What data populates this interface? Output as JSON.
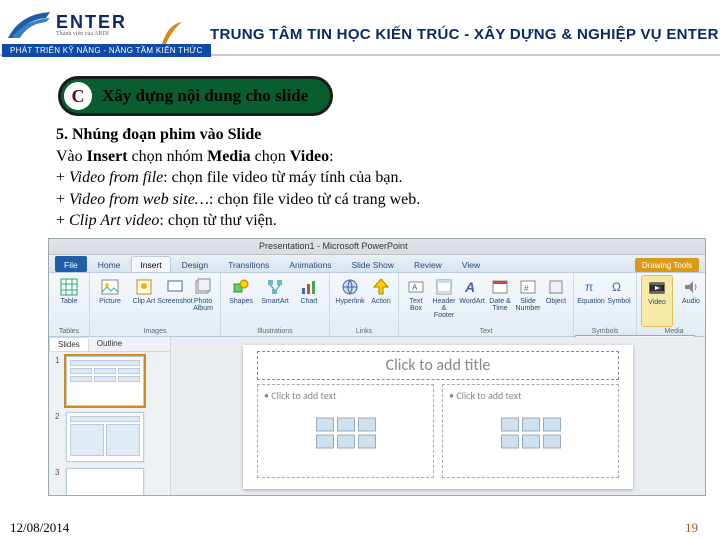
{
  "header": {
    "brand": "ENTER",
    "brand_sub": "Thành viên của ARDI",
    "tagline": "PHÁT TRIỂN KỸ NĂNG - NÂNG TẦM KIẾN THỨC",
    "center_title": "TRUNG TÂM TIN HỌC KIẾN TRÚC - XÂY DỰNG & NGHIỆP VỤ ENTER"
  },
  "section": {
    "letter": "C",
    "title": "Xây dựng nội dung cho slide"
  },
  "body": {
    "line1_head": "5.   Nhúng đoạn phim vào Slide",
    "line2_a": "Vào ",
    "line2_b": "Insert",
    "line2_c": " chọn nhóm ",
    "line2_d": "Media",
    "line2_e": "  chọn ",
    "line2_f": "Video",
    "line2_g": ":",
    "line3_a": "+ ",
    "line3_b": "Video from file",
    "line3_c": ": chọn file video từ máy tính của bạn.",
    "line4_a": "+ ",
    "line4_b": "Video from web site…",
    "line4_c": ": chọn file video từ cá trang web.",
    "line5_a": "+ ",
    "line5_b": "Clip Art video",
    "line5_c": ": chọn từ thư viện."
  },
  "ppt": {
    "window_title": "Presentation1 - Microsoft PowerPoint",
    "tabs": [
      "File",
      "Home",
      "Insert",
      "Design",
      "Transitions",
      "Animations",
      "Slide Show",
      "Review",
      "View"
    ],
    "tab_right": "Drawing Tools",
    "groups": {
      "tables": {
        "name": "Tables",
        "items": [
          "Table"
        ]
      },
      "images": {
        "name": "Images",
        "items": [
          "Picture",
          "Clip Art",
          "Screenshot",
          "Photo Album"
        ]
      },
      "illustrations": {
        "name": "Illustrations",
        "items": [
          "Shapes",
          "SmartArt",
          "Chart"
        ]
      },
      "links": {
        "name": "Links",
        "items": [
          "Hyperlink",
          "Action"
        ]
      },
      "text": {
        "name": "Text",
        "items": [
          "Text Box",
          "Header & Footer",
          "WordArt",
          "Date & Time",
          "Slide Number",
          "Object"
        ]
      },
      "symbols": {
        "name": "Symbols",
        "items": [
          "Equation",
          "Symbol"
        ]
      },
      "media": {
        "name": "Media",
        "items": [
          "Video",
          "Audio"
        ]
      }
    },
    "thumb_tabs": [
      "Slides",
      "Outline"
    ],
    "slide_title_ph": "Click to add title",
    "slide_text_ph": "Click to add text",
    "dropdown": [
      "Video from File...",
      "Video from Web Site...",
      "Clip Art Video..."
    ]
  },
  "footer": {
    "date": "12/08/2014",
    "page": "19"
  }
}
